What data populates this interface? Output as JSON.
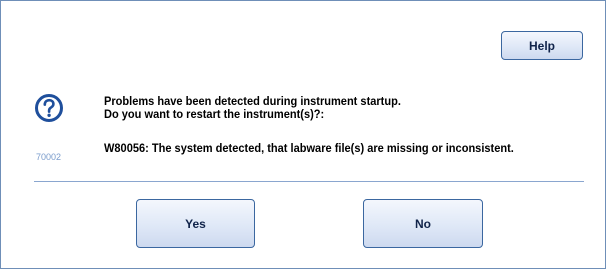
{
  "dialog": {
    "help_label": "Help",
    "code": "70002",
    "message_line1": "Problems have been detected during instrument startup.",
    "message_line2": "Do you want to restart the instrument(s)?:",
    "detail": "W80056: The system detected, that labware file(s) are missing or inconsistent.",
    "yes_label": "Yes",
    "no_label": "No",
    "icon": "question-circle-icon"
  },
  "colors": {
    "border": "#6f8fb8",
    "icon_blue": "#1f4f9c",
    "code_text": "#7a9ccc",
    "button_border": "#3b67a0"
  }
}
